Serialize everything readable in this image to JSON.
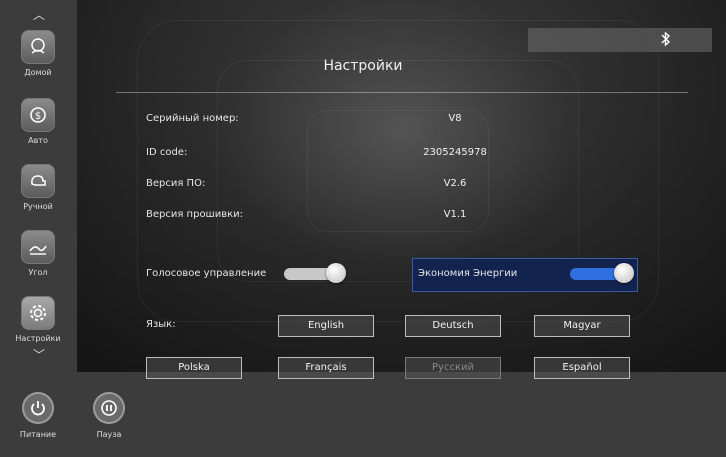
{
  "sidebar": {
    "items": [
      {
        "label": "Домой",
        "icon": "home-icon"
      },
      {
        "label": "Авто",
        "icon": "auto-icon"
      },
      {
        "label": "Ручной",
        "icon": "manual-icon"
      },
      {
        "label": "Угол",
        "icon": "angle-icon"
      },
      {
        "label": "Настройки",
        "icon": "gear-icon",
        "active": true
      }
    ]
  },
  "bottom": {
    "power_label": "Питание",
    "pause_label": "Пауза"
  },
  "header": {
    "title": "Настройки",
    "bluetooth_icon": "bluetooth-icon"
  },
  "info": [
    {
      "label": "Серийный номер:",
      "value": "V8"
    },
    {
      "label": "ID code:",
      "value": "2305245978"
    },
    {
      "label": "Версия ПО:",
      "value": "V2.6"
    },
    {
      "label": "Версия прошивки:",
      "value": "V1.1"
    }
  ],
  "toggles": {
    "voice": {
      "label": "Голосовое управление",
      "on": true
    },
    "energy": {
      "label": "Экономия Энергии",
      "on": true
    }
  },
  "language": {
    "label": "Язык:",
    "options": [
      "English",
      "Deutsch",
      "Magyar",
      "Polska",
      "Français",
      "Русский",
      "Español"
    ],
    "selected": "Русский"
  },
  "colors": {
    "accent": "#2f6fe0",
    "energy_bg": "#12234f"
  }
}
